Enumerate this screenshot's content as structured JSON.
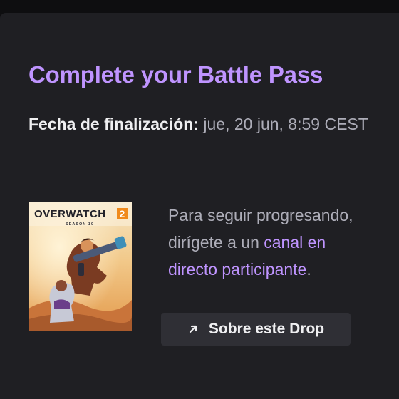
{
  "card": {
    "title": "Complete your Battle Pass",
    "end_date_label": "Fecha de finalización:",
    "end_date_value": "jue, 20 jun, 8:59 CEST",
    "boxart": {
      "logo_text": "OVERWATCH",
      "logo_number": "2",
      "subtitle": "SEASON 10"
    },
    "description": {
      "before_link": "Para seguir progresando, dirígete a un ",
      "link_text": "canal en directo participante",
      "after_link": "."
    },
    "drop_button_label": "Sobre este Drop",
    "drop_button_icon": "arrow-up-right-icon",
    "colors": {
      "accent": "#bf94ff",
      "background": "#1f1f23",
      "button": "#2f2f35"
    }
  }
}
